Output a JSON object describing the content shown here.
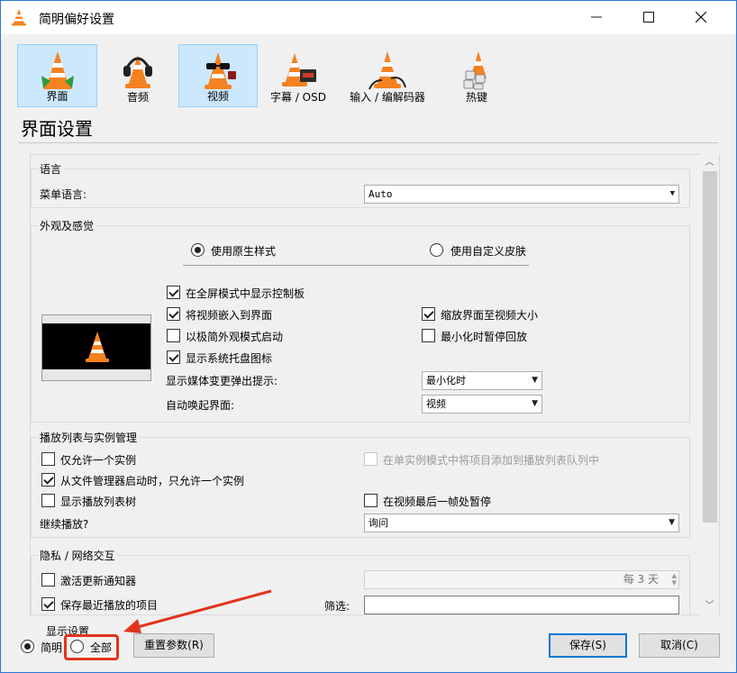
{
  "window": {
    "title": "简明偏好设置"
  },
  "categories": [
    {
      "label": "界面",
      "selected": true,
      "icon": "vlc-interface-icon"
    },
    {
      "label": "音频",
      "selected": false,
      "icon": "vlc-audio-headphones-icon"
    },
    {
      "label": "视频",
      "selected": true,
      "icon": "vlc-video-glasses-icon"
    },
    {
      "label": "字幕 / OSD",
      "selected": false,
      "icon": "vlc-subtitles-icon"
    },
    {
      "label": "输入 / 编解码器",
      "selected": false,
      "icon": "vlc-input-codecs-icon"
    },
    {
      "label": "热键",
      "selected": false,
      "icon": "vlc-hotkeys-icon"
    }
  ],
  "section_title": "界面设置",
  "language": {
    "group_title": "语言",
    "menu_language_label": "菜单语言:",
    "menu_language_value": "Auto"
  },
  "appearance": {
    "group_title": "外观及感觉",
    "native_style": "使用原生样式",
    "custom_skin": "使用自定义皮肤",
    "checkboxes": [
      {
        "label": "在全屏模式中显示控制板",
        "checked": true
      },
      {
        "label": "将视频嵌入到界面",
        "checked": true
      },
      {
        "label": "以极简外观模式启动",
        "checked": false
      },
      {
        "label": "显示系统托盘图标",
        "checked": true
      },
      {
        "label": "缩放界面至视频大小",
        "checked": true
      },
      {
        "label": "最小化时暂停回放",
        "checked": false
      }
    ],
    "popup_label": "显示媒体变更弹出提示:",
    "popup_value": "最小化时",
    "raise_label": "自动唤起界面:",
    "raise_value": "视频"
  },
  "playlist": {
    "group_title": "播放列表与实例管理",
    "checkboxes": [
      {
        "label": "仅允许一个实例",
        "checked": false
      },
      {
        "label": "从文件管理器启动时，只允许一个实例",
        "checked": true
      },
      {
        "label": "显示播放列表树",
        "checked": false
      },
      {
        "label": "在单实例模式中将项目添加到播放列表队列中",
        "checked": false,
        "disabled": true
      },
      {
        "label": "在视频最后一帧处暂停",
        "checked": false
      }
    ],
    "continue_label": "继续播放?",
    "continue_value": "询问"
  },
  "privacy": {
    "group_title": "隐私 / 网络交互",
    "update_notifier": "激活更新通知器",
    "update_checked": false,
    "update_interval": "每 3 天",
    "save_recent": "保存最近播放的项目",
    "save_recent_checked": true,
    "filter_label": "筛选:",
    "filter_value": ""
  },
  "bottom": {
    "show_settings_label": "显示设置",
    "simple_label": "简明",
    "all_label": "全部",
    "reset_button": "重置参数(R)",
    "save_button": "保存(S)",
    "cancel_button": "取消(C)"
  },
  "colors": {
    "accent": "#0078d7",
    "selected_tab_bg": "#cce8ff",
    "annotation": "#e2341d"
  }
}
